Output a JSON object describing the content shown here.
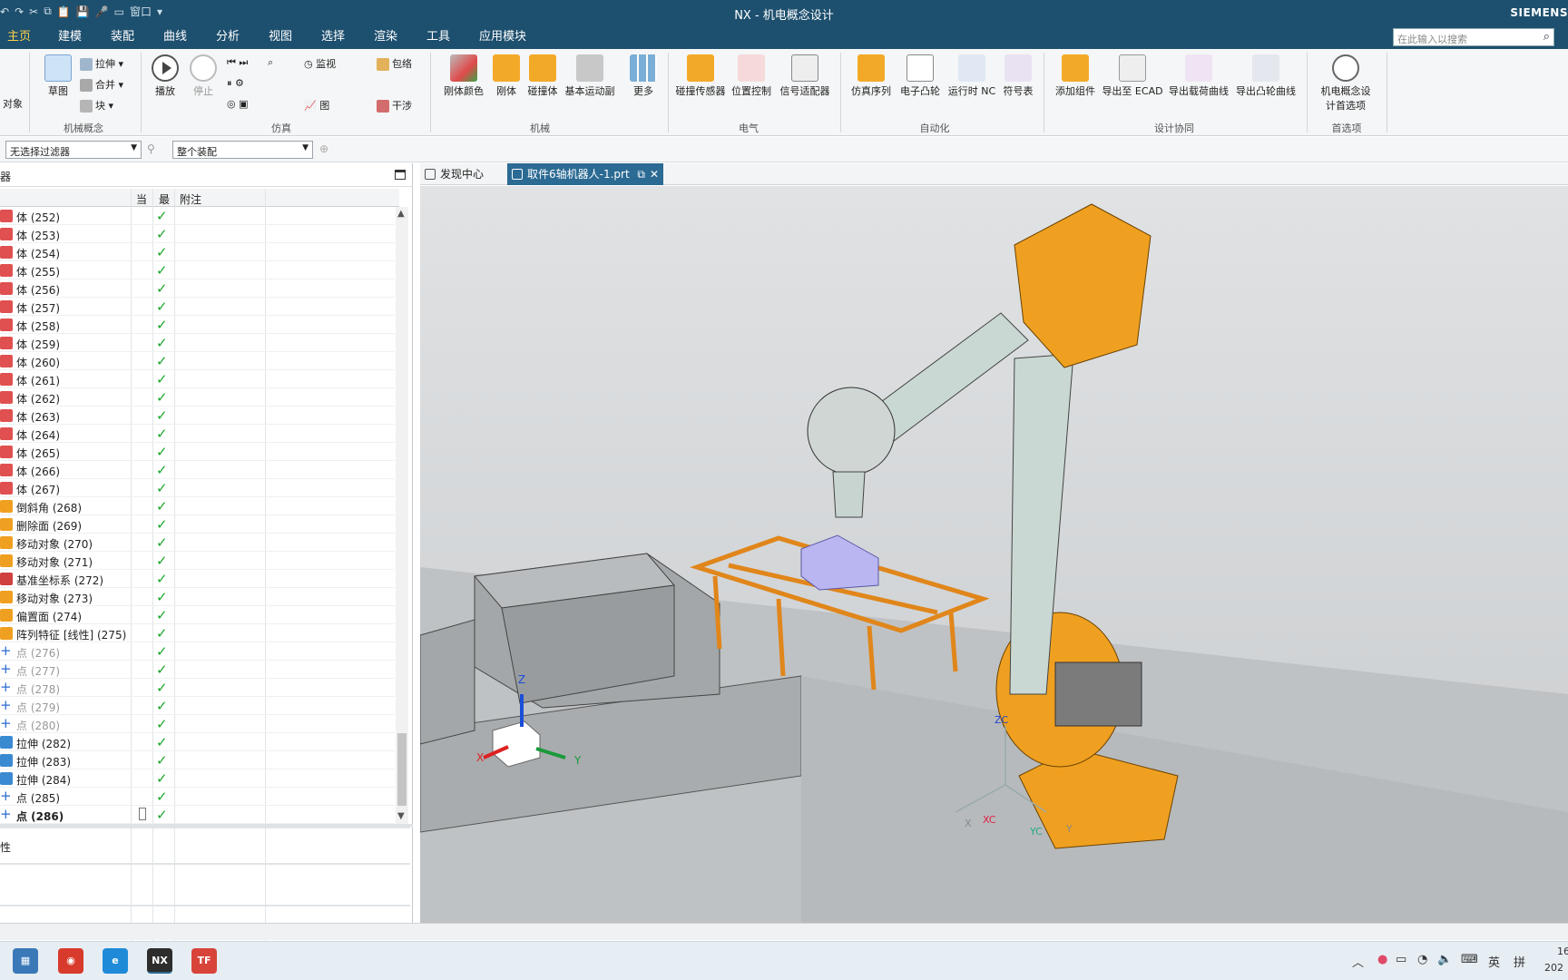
{
  "window": {
    "title": "NX - 机电概念设计",
    "brand": "SIEMENS",
    "qa_window": "窗口"
  },
  "menu": {
    "tabs": [
      "主页",
      "建模",
      "装配",
      "曲线",
      "分析",
      "视图",
      "选择",
      "渲染",
      "工具",
      "应用模块"
    ],
    "active": "主页",
    "search_placeholder": "在此输入以搜索"
  },
  "ribbon": {
    "object_label": "对象",
    "sketch": "草图",
    "extrude": "拉伸",
    "unite": "合并",
    "block": "块",
    "group_concept": "机械概念",
    "play": "播放",
    "stop": "停止",
    "monitor": "监视",
    "wrap": "包络",
    "graph": "图",
    "interference": "干涉",
    "group_sim": "仿真",
    "rigid_color": "刚体颜色",
    "rigid_body": "刚体",
    "collision_body": "碰撞体",
    "basic_joint": "基本运动副",
    "more": "更多",
    "group_mech": "机械",
    "collision_sensor": "碰撞传感器",
    "position_control": "位置控制",
    "signal_adapter": "信号适配器",
    "group_elec": "电气",
    "sim_sequence": "仿真序列",
    "electronic_cam": "电子凸轮",
    "runtime_nc": "运行时 NC",
    "symbol_table": "符号表",
    "group_auto": "自动化",
    "add_component": "添加组件",
    "export_ecad": "导出至 ECAD",
    "export_load": "导出载荷曲线",
    "export_cam": "导出凸轮曲线",
    "group_collab": "设计协同",
    "prefs_line1": "机电概念设",
    "prefs_line2": "计首选项",
    "group_prefs": "首选项"
  },
  "filterbar": {
    "filter": "无选择过滤器",
    "scope": "整个装配"
  },
  "navigator": {
    "title": "器",
    "columns": {
      "name": "",
      "current": "当",
      "latest": "最",
      "note": "附注"
    },
    "rows": [
      {
        "label": "体 (252)",
        "icon": "body-icon",
        "dim": false
      },
      {
        "label": "体 (253)",
        "icon": "body-icon",
        "dim": false
      },
      {
        "label": "体 (254)",
        "icon": "body-icon",
        "dim": false
      },
      {
        "label": "体 (255)",
        "icon": "body-icon",
        "dim": false
      },
      {
        "label": "体 (256)",
        "icon": "body-icon",
        "dim": false
      },
      {
        "label": "体 (257)",
        "icon": "body-icon",
        "dim": false
      },
      {
        "label": "体 (258)",
        "icon": "body-icon",
        "dim": false
      },
      {
        "label": "体 (259)",
        "icon": "body-icon",
        "dim": false
      },
      {
        "label": "体 (260)",
        "icon": "body-icon",
        "dim": false
      },
      {
        "label": "体 (261)",
        "icon": "body-icon",
        "dim": false
      },
      {
        "label": "体 (262)",
        "icon": "body-icon",
        "dim": false
      },
      {
        "label": "体 (263)",
        "icon": "body-icon",
        "dim": false
      },
      {
        "label": "体 (264)",
        "icon": "body-icon",
        "dim": false
      },
      {
        "label": "体 (265)",
        "icon": "body-icon",
        "dim": false
      },
      {
        "label": "体 (266)",
        "icon": "body-icon",
        "dim": false
      },
      {
        "label": "体 (267)",
        "icon": "body-icon",
        "dim": false
      },
      {
        "label": "倒斜角 (268)",
        "icon": "chamfer-icon",
        "dim": false
      },
      {
        "label": "删除面 (269)",
        "icon": "delete-face-icon",
        "dim": false
      },
      {
        "label": "移动对象 (270)",
        "icon": "move-object-icon",
        "dim": false
      },
      {
        "label": "移动对象 (271)",
        "icon": "move-object-icon",
        "dim": false
      },
      {
        "label": "基准坐标系 (272)",
        "icon": "datum-csys-icon",
        "dim": false
      },
      {
        "label": "移动对象 (273)",
        "icon": "move-object-icon",
        "dim": false
      },
      {
        "label": "偏置面 (274)",
        "icon": "offset-face-icon",
        "dim": false
      },
      {
        "label": "阵列特征 [线性] (275)",
        "icon": "pattern-icon",
        "dim": false
      },
      {
        "label": "点 (276)",
        "icon": "point-icon",
        "dim": true
      },
      {
        "label": "点 (277)",
        "icon": "point-icon",
        "dim": true
      },
      {
        "label": "点 (278)",
        "icon": "point-icon",
        "dim": true
      },
      {
        "label": "点 (279)",
        "icon": "point-icon",
        "dim": true
      },
      {
        "label": "点 (280)",
        "icon": "point-icon",
        "dim": true
      },
      {
        "label": "拉伸 (282)",
        "icon": "extrude-icon",
        "dim": false
      },
      {
        "label": "拉伸 (283)",
        "icon": "extrude-icon",
        "dim": false
      },
      {
        "label": "拉伸 (284)",
        "icon": "extrude-icon",
        "dim": false
      },
      {
        "label": "点 (285)",
        "icon": "point-icon",
        "dim": false
      },
      {
        "label": "点 (286)",
        "icon": "point-icon",
        "dim": false,
        "bold": true,
        "current": true
      }
    ],
    "lower_label": "性"
  },
  "doc_tabs": [
    {
      "label": "发现中心",
      "active": false
    },
    {
      "label": "取件6轴机器人-1.prt",
      "active": true
    }
  ],
  "viewport": {
    "triad": {
      "x": "X",
      "y": "Y",
      "z": "Z"
    },
    "csys": {
      "xc": "XC",
      "yc": "YC",
      "zc": "ZC",
      "x": "X",
      "y": "Y"
    }
  },
  "taskbar": {
    "apps": [
      "calculator-icon",
      "browser-red-icon",
      "edge-icon",
      "NX",
      "TF"
    ],
    "ime_lang": "英",
    "ime_mode": "拼",
    "clock_fragment": "16",
    "date_fragment": "202"
  },
  "colors": {
    "titlebar": "#1d4f6e",
    "accent_tab": "#ffd24a",
    "robot": "#f0a020",
    "check": "#1aa52a"
  }
}
